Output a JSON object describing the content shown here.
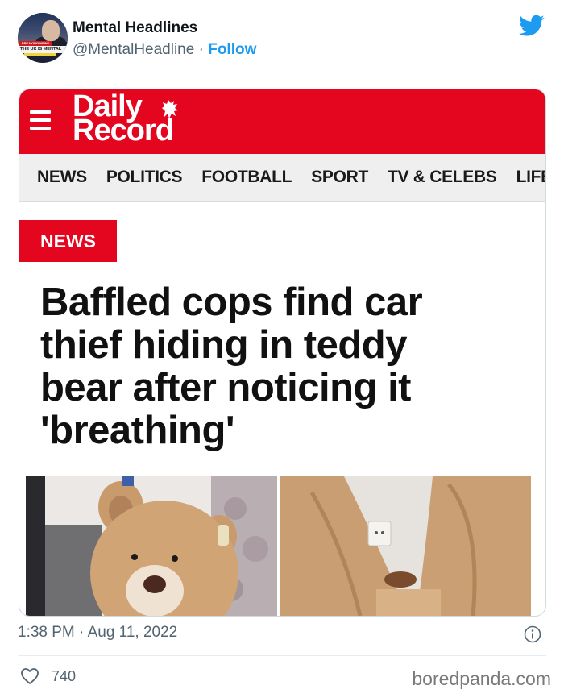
{
  "tweet": {
    "account_name": "Mental Headlines",
    "handle": "@MentalHeadline",
    "separator": " · ",
    "follow_label": "Follow",
    "avatar_text": {
      "breaking": "BREAKING NEWS",
      "banner": "THE UK IS MENTAL"
    },
    "brand_color": "#1d9bf0"
  },
  "article": {
    "site_name_line1": "Daily",
    "site_name_line2": "Record",
    "nav_items": [
      "NEWS",
      "POLITICS",
      "FOOTBALL",
      "SPORT",
      "TV & CELEBS",
      "LIFE &"
    ],
    "section_badge": "NEWS",
    "headline_lines": [
      "Baffled cops find car",
      "thief hiding in teddy",
      "bear after noticing it",
      "'breathing'"
    ],
    "brand_red": "#e4051f"
  },
  "footer": {
    "timestamp": "1:38 PM · Aug 11, 2022",
    "like_count": "740",
    "watermark": "boredpanda.com"
  }
}
